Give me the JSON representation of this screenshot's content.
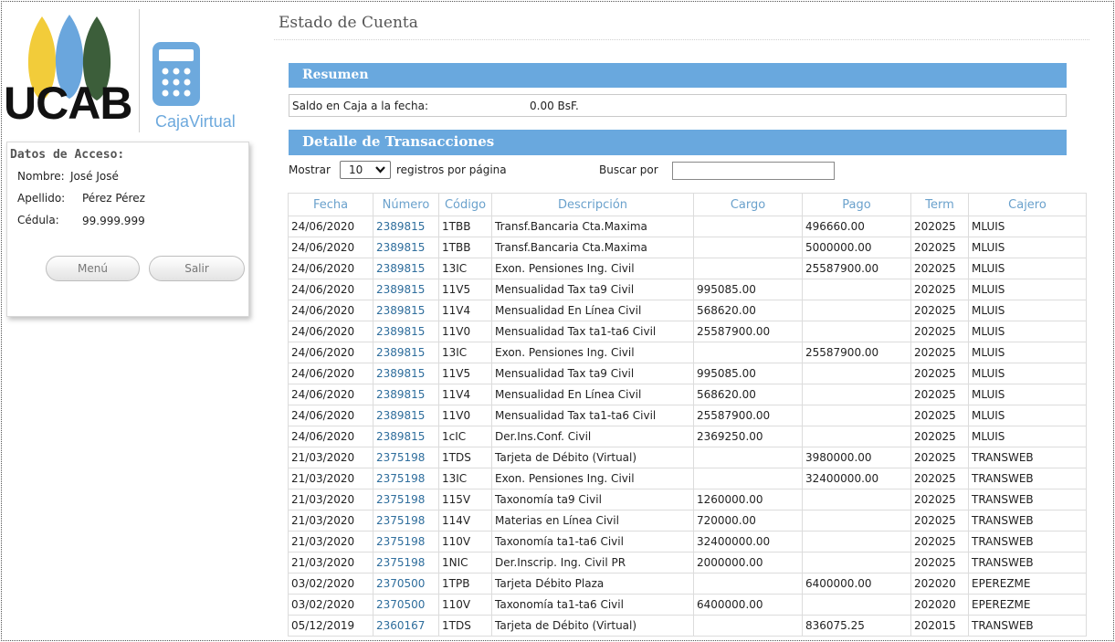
{
  "logo": {
    "text": "UCAB",
    "subtitle": "CajaVirtual",
    "leaf_colors": [
      "#f2cc3a",
      "#6aa6dd",
      "#3c5e3a"
    ]
  },
  "access": {
    "title": "Datos de Acceso:",
    "nombre_label": "Nombre:",
    "nombre": "José José",
    "apellido_label": "Apellido:",
    "apellido": "Pérez Pérez",
    "cedula_label": "Cédula:",
    "cedula": "99.999.999",
    "menu_label": "Menú",
    "salir_label": "Salir"
  },
  "page": {
    "title": "Estado de Cuenta"
  },
  "resumen": {
    "title": "Resumen",
    "saldo_label": "Saldo en Caja a la fecha:",
    "saldo_value": "0.00 BsF."
  },
  "detalle": {
    "title": "Detalle de Transacciones",
    "mostrar_label": "Mostrar",
    "page_size": "10",
    "registros_label": "registros por página",
    "buscar_label": "Buscar por",
    "search_value": ""
  },
  "table": {
    "headers": [
      "Fecha",
      "Número",
      "Código",
      "Descripción",
      "Cargo",
      "Pago",
      "Term",
      "Cajero"
    ],
    "rows": [
      [
        "24/06/2020",
        "2389815",
        "1TBB",
        "Transf.Bancaria Cta.Maxima",
        "",
        "496660.00",
        "202025",
        "MLUIS"
      ],
      [
        "24/06/2020",
        "2389815",
        "1TBB",
        "Transf.Bancaria Cta.Maxima",
        "",
        "5000000.00",
        "202025",
        "MLUIS"
      ],
      [
        "24/06/2020",
        "2389815",
        "13IC",
        "Exon. Pensiones Ing. Civil",
        "",
        "25587900.00",
        "202025",
        "MLUIS"
      ],
      [
        "24/06/2020",
        "2389815",
        "11V5",
        "Mensualidad Tax ta9 Civil",
        "995085.00",
        "",
        "202025",
        "MLUIS"
      ],
      [
        "24/06/2020",
        "2389815",
        "11V4",
        "Mensualidad En Línea Civil",
        "568620.00",
        "",
        "202025",
        "MLUIS"
      ],
      [
        "24/06/2020",
        "2389815",
        "11V0",
        "Mensualidad Tax ta1-ta6 Civil",
        "25587900.00",
        "",
        "202025",
        "MLUIS"
      ],
      [
        "24/06/2020",
        "2389815",
        "13IC",
        "Exon. Pensiones Ing. Civil",
        "",
        "25587900.00",
        "202025",
        "MLUIS"
      ],
      [
        "24/06/2020",
        "2389815",
        "11V5",
        "Mensualidad Tax ta9 Civil",
        "995085.00",
        "",
        "202025",
        "MLUIS"
      ],
      [
        "24/06/2020",
        "2389815",
        "11V4",
        "Mensualidad En Línea Civil",
        "568620.00",
        "",
        "202025",
        "MLUIS"
      ],
      [
        "24/06/2020",
        "2389815",
        "11V0",
        "Mensualidad Tax ta1-ta6 Civil",
        "25587900.00",
        "",
        "202025",
        "MLUIS"
      ],
      [
        "24/06/2020",
        "2389815",
        "1cIC",
        "Der.Ins.Conf. Civil",
        "2369250.00",
        "",
        "202025",
        "MLUIS"
      ],
      [
        "21/03/2020",
        "2375198",
        "1TDS",
        "Tarjeta de Débito (Virtual)",
        "",
        "3980000.00",
        "202025",
        "TRANSWEB"
      ],
      [
        "21/03/2020",
        "2375198",
        "13IC",
        "Exon. Pensiones Ing. Civil",
        "",
        "32400000.00",
        "202025",
        "TRANSWEB"
      ],
      [
        "21/03/2020",
        "2375198",
        "115V",
        "Taxonomía ta9 Civil",
        "1260000.00",
        "",
        "202025",
        "TRANSWEB"
      ],
      [
        "21/03/2020",
        "2375198",
        "114V",
        "Materias en Línea Civil",
        "720000.00",
        "",
        "202025",
        "TRANSWEB"
      ],
      [
        "21/03/2020",
        "2375198",
        "110V",
        "Taxonomía ta1-ta6 Civil",
        "32400000.00",
        "",
        "202025",
        "TRANSWEB"
      ],
      [
        "21/03/2020",
        "2375198",
        "1NIC",
        "Der.Inscrip. Ing. Civil PR",
        "2000000.00",
        "",
        "202025",
        "TRANSWEB"
      ],
      [
        "03/02/2020",
        "2370500",
        "1TPB",
        "Tarjeta Débito Plaza",
        "",
        "6400000.00",
        "202020",
        "EPEREZME"
      ],
      [
        "03/02/2020",
        "2370500",
        "110V",
        "Taxonomía ta1-ta6 Civil",
        "6400000.00",
        "",
        "202020",
        "EPEREZME"
      ],
      [
        "05/12/2019",
        "2360167",
        "1TDS",
        "Tarjeta de Débito (Virtual)",
        "",
        "836075.25",
        "202015",
        "TRANSWEB"
      ]
    ]
  }
}
